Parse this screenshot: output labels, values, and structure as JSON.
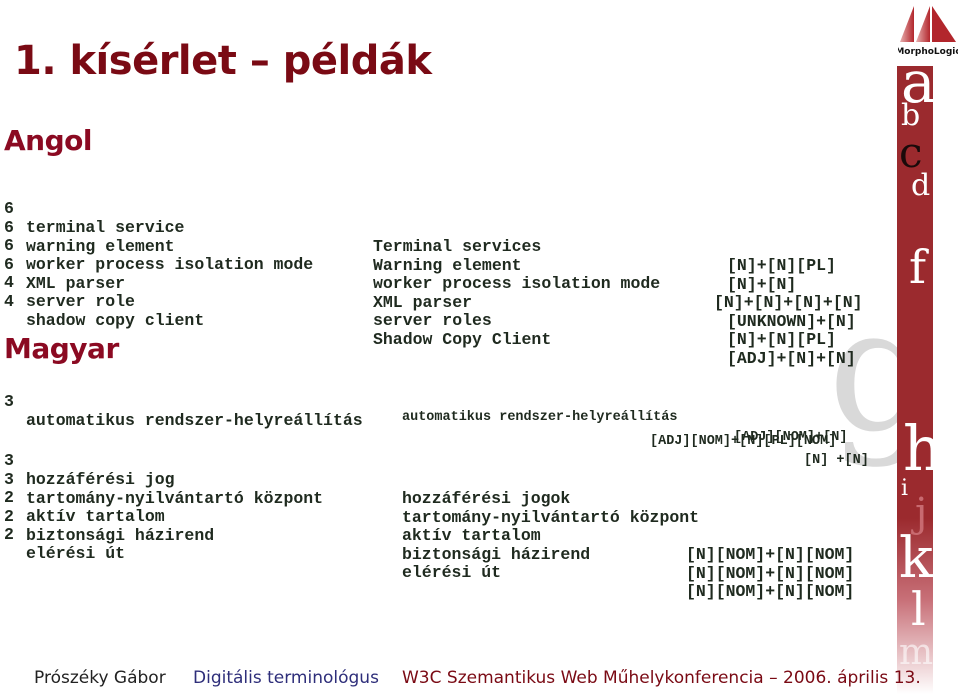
{
  "logo": {
    "brand": "MorphoLogic",
    "icon": "morphologic-m-logo"
  },
  "title": "1. kísérlet – példák",
  "sections": {
    "english": {
      "heading": "Angol",
      "rows": [
        {
          "count": "6",
          "term": "terminal service",
          "match": "Terminal services",
          "tags": "[N]+[N][PL]"
        },
        {
          "count": "6",
          "term": "warning element",
          "match": "Warning element",
          "tags": "[N]+[N]"
        },
        {
          "count": "6",
          "term": "worker process isolation mode",
          "match": "worker process isolation mode",
          "tags": "[N]+[N]+[N]+[N]"
        },
        {
          "count": "6",
          "term": "XML parser",
          "match": "XML parser",
          "tags": "[UNKNOWN]+[N]"
        },
        {
          "count": "4",
          "term": "server role",
          "match": "server roles",
          "tags": "[N]+[N][PL]"
        },
        {
          "count": "4",
          "term": "shadow copy client",
          "match": "Shadow Copy Client",
          "tags": "[ADJ]+[N]+[N]"
        }
      ]
    },
    "hungarian": {
      "heading": "Magyar",
      "first": {
        "count": "3",
        "term": "automatikus rendszer-helyreállítás",
        "match": "automatikus rendszer-helyreállítás",
        "tags": "[ADJ][NOM]+[N]"
      },
      "rows": [
        {
          "count": "3",
          "term": "hozzáférési jog",
          "match": "hozzáférési jogok",
          "tags": "[ADJ][NOM]+[N][PL][NOM]"
        },
        {
          "count": "3",
          "term": "tartomány-nyilvántartó központ",
          "match": "tartomány-nyilvántartó központ",
          "tags": "[N] +[N]"
        },
        {
          "count": "2",
          "term": "aktív tartalom",
          "match": "aktív tartalom",
          "tags": "[N][NOM]+[N][NOM]"
        },
        {
          "count": "2",
          "term": "biztonsági házirend",
          "match": "biztonsági házirend",
          "tags": "[N][NOM]+[N][NOM]"
        },
        {
          "count": "2",
          "term": "elérési út",
          "match": "elérési út",
          "tags": "[N][NOM]+[N][NOM]"
        }
      ]
    }
  },
  "sidebar_letters": [
    "a",
    "b",
    "c",
    "d",
    "f",
    "g",
    "h",
    "i",
    "j",
    "k",
    "l",
    "m"
  ],
  "footer": {
    "author": "Prószéky Gábor",
    "talk": "Digitális terminológus",
    "event": "W3C Szemantikus Web Műhelykonferencia – 2006. április 13."
  },
  "colors": {
    "title": "#7a0a14",
    "heading": "#8b0a22",
    "sidebar": "#9b2a2e",
    "talk": "#2e2e7a",
    "text": "#1f2a1f"
  }
}
